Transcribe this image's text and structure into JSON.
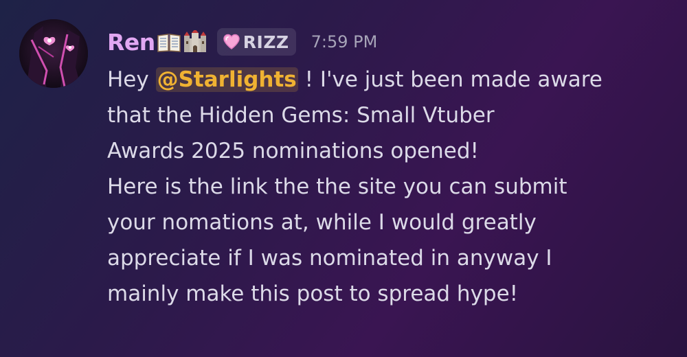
{
  "message": {
    "author": "Ren",
    "author_emojis": [
      "open-book-emoji",
      "castle-emoji"
    ],
    "author_color": "#e1a7f2",
    "tag": {
      "icon": "pink-heart-icon",
      "label": "RIZZ"
    },
    "timestamp": "7:59 PM",
    "mention": {
      "name": "@Starlights",
      "color": "#f0b232"
    },
    "lines": [
      {
        "before": "Hey ",
        "after": " ! I've just been made aware"
      },
      "that the Hidden Gems: Small Vtuber",
      "Awards 2025 nominations opened!",
      "Here is the link the the site you can submit",
      "your nomations at, while I would greatly",
      "appreciate if I was nominated in anyway I",
      "mainly make this post to spread hype!"
    ]
  }
}
